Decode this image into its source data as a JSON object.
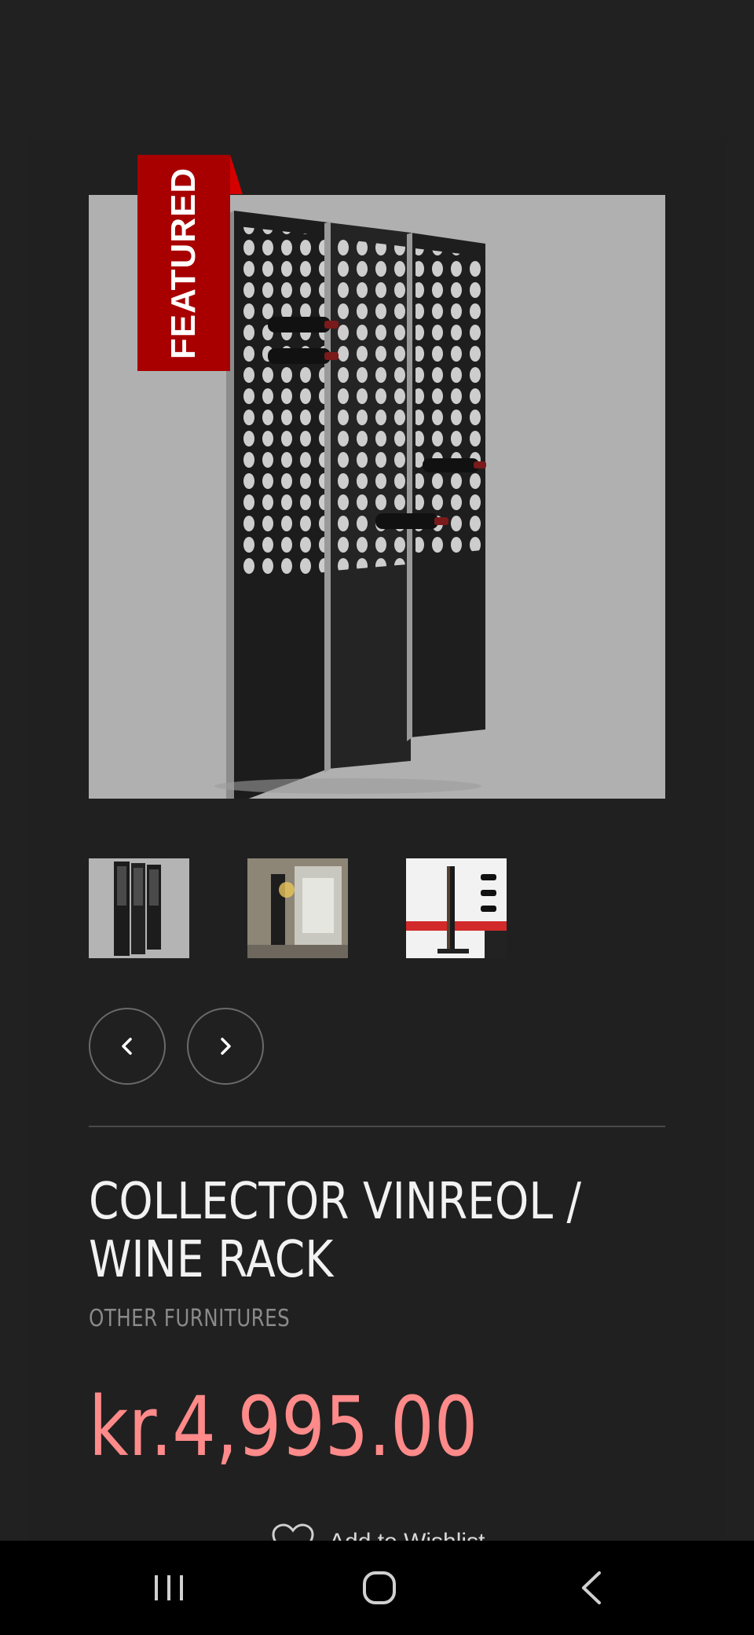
{
  "product": {
    "badge": "FEATURED",
    "title": "COLLECTOR VINREOL / WINE RACK",
    "category": "OTHER FURNITURES",
    "price": "kr.4,995.00",
    "wishlist_label": "Add to Wishlist"
  },
  "gallery": {
    "thumbnails": [
      "thumbnail-1",
      "thumbnail-2",
      "thumbnail-3"
    ],
    "prev_icon": "chevron-left-icon",
    "next_icon": "chevron-right-icon"
  },
  "system_nav": {
    "recent_icon": "recent-apps-icon",
    "home_icon": "home-icon",
    "back_icon": "back-icon"
  },
  "colors": {
    "background": "#212121",
    "badge": "#a80000",
    "price": "#ff8a8a",
    "title": "#f2f2f2",
    "category": "#8a8a8a"
  }
}
